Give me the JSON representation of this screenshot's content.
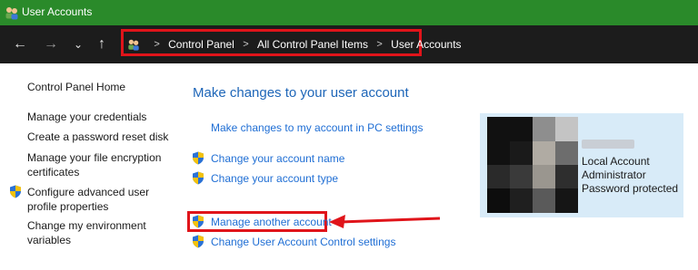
{
  "window": {
    "title": "User Accounts"
  },
  "nav": {
    "breadcrumbs": [
      "Control Panel",
      "All Control Panel Items",
      "User Accounts"
    ]
  },
  "sidebar": {
    "items": [
      {
        "label": "Control Panel Home"
      },
      {
        "label": "Manage your credentials"
      },
      {
        "label": "Create a password reset disk"
      },
      {
        "label": "Manage your file encryption certificates"
      },
      {
        "label": "Configure advanced user profile properties"
      },
      {
        "label": "Change my environment variables"
      }
    ]
  },
  "main": {
    "heading": "Make changes to your user account",
    "links": {
      "pc_settings": "Make changes to my account in PC settings",
      "change_name": "Change your account name",
      "change_type": "Change your account type",
      "manage_another": "Manage another account",
      "uac_settings": "Change User Account Control settings"
    }
  },
  "user": {
    "lines": [
      "Local Account",
      "Administrator",
      "Password protected"
    ]
  },
  "colors": {
    "titlebar": "#2a8a2a",
    "navbar": "#1c1c1c",
    "highlight": "#e0141a",
    "link": "#1f6ed4",
    "card": "#d8ebf8"
  }
}
